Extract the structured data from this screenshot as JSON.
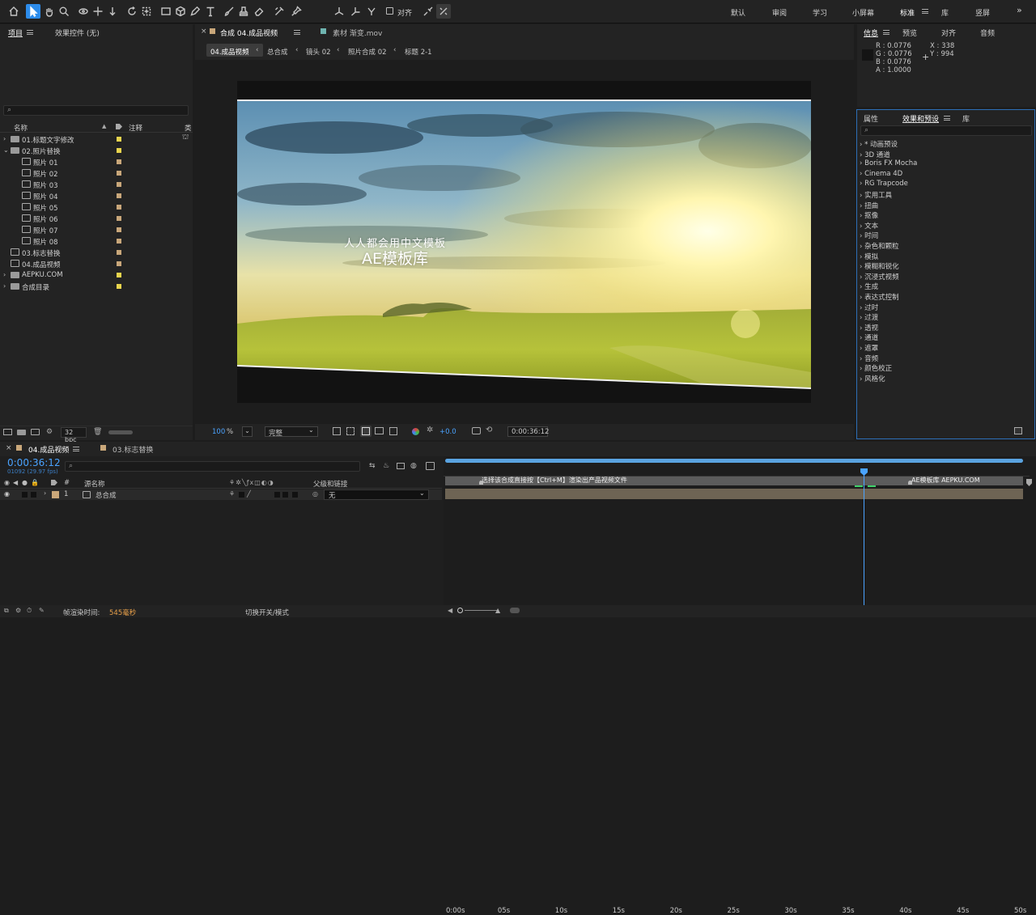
{
  "toolbar": {
    "tools": [
      "home-icon",
      "selection-tool-icon",
      "hand-tool-icon",
      "zoom-tool-icon",
      "orbit-camera-icon",
      "pan-camera-icon",
      "dolly-camera-icon",
      "rotation-tool-icon",
      "pan-behind-icon",
      "rectangle-tool-icon",
      "shape-3d-icon",
      "pen-tool-icon",
      "type-tool-icon",
      "brush-tool-icon",
      "clone-stamp-icon",
      "eraser-icon",
      "roto-brush-icon",
      "puppet-pin-icon"
    ],
    "snap_label": "对齐",
    "workspaces": [
      "默认",
      "审阅",
      "学习",
      "小屏幕",
      "标准",
      "库",
      "竖屏"
    ],
    "active_workspace": "标准",
    "more": "»"
  },
  "project_panel": {
    "tabs": [
      "项目",
      "效果控件 (无)"
    ],
    "columns": {
      "name": "名称",
      "comment": "注释",
      "type": "类"
    },
    "items": [
      {
        "label": "01.标题文字修改",
        "kind": "folder",
        "depth": 0,
        "expanded": false,
        "color": "#e8d44d"
      },
      {
        "label": "02.照片替换",
        "kind": "folder",
        "depth": 0,
        "expanded": true,
        "color": "#e8d44d"
      },
      {
        "label": "照片 01",
        "kind": "comp",
        "depth": 2,
        "color": "#c9a77a"
      },
      {
        "label": "照片 02",
        "kind": "comp",
        "depth": 2,
        "color": "#c9a77a"
      },
      {
        "label": "照片 03",
        "kind": "comp",
        "depth": 2,
        "color": "#c9a77a"
      },
      {
        "label": "照片 04",
        "kind": "comp",
        "depth": 2,
        "color": "#c9a77a"
      },
      {
        "label": "照片 05",
        "kind": "comp",
        "depth": 2,
        "color": "#c9a77a"
      },
      {
        "label": "照片 06",
        "kind": "comp",
        "depth": 2,
        "color": "#c9a77a"
      },
      {
        "label": "照片 07",
        "kind": "comp",
        "depth": 2,
        "color": "#c9a77a"
      },
      {
        "label": "照片 08",
        "kind": "comp",
        "depth": 2,
        "color": "#c9a77a"
      },
      {
        "label": "03.标志替换",
        "kind": "comp",
        "depth": 1,
        "color": "#c9a77a"
      },
      {
        "label": "04.成品视频",
        "kind": "comp",
        "depth": 1,
        "color": "#c9a77a"
      },
      {
        "label": "AEPKU.COM",
        "kind": "folder",
        "depth": 0,
        "expanded": false,
        "color": "#e8d44d"
      },
      {
        "label": "合成目录",
        "kind": "folder",
        "depth": 0,
        "expanded": false,
        "color": "#e8d44d"
      }
    ],
    "bpc": "32 bpc"
  },
  "viewer": {
    "tabs": [
      "合成 04.成品视频",
      "素材 渐变.mov"
    ],
    "breadcrumbs": [
      "04.成品视频",
      "总合成",
      "镜头 02",
      "照片合成 02",
      "标题 2-1"
    ],
    "overlay_line1": "人人都会用中文模板",
    "overlay_line2": "AE模板库",
    "zoom": "100",
    "zoom_unit": "%",
    "resolution": "完整",
    "exposure": "+0.0",
    "timecode": "0:00:36:12"
  },
  "info_panel": {
    "tabs": [
      "信息",
      "预览",
      "对齐",
      "音频"
    ],
    "r": "R : 0.0776",
    "g": "G : 0.0776",
    "b": "B : 0.0776",
    "a": "A : 1.0000",
    "x": "X : 338",
    "y": "Y : 994"
  },
  "effects_panel": {
    "tabs": [
      "属性",
      "效果和预设",
      "库"
    ],
    "items": [
      "* 动画预设",
      "3D 通道",
      "Boris FX Mocha",
      "Cinema 4D",
      "RG Trapcode",
      "实用工具",
      "扭曲",
      "抠像",
      "文本",
      "时间",
      "杂色和颗粒",
      "模拟",
      "模糊和锐化",
      "沉浸式视频",
      "生成",
      "表达式控制",
      "过时",
      "过渡",
      "透视",
      "通道",
      "遮罩",
      "音频",
      "颜色校正",
      "风格化"
    ]
  },
  "timeline": {
    "tabs": [
      "04.成品视频",
      "03.标志替换"
    ],
    "timecode": "0:00:36:12",
    "frame_info": "01092 (29.97 fps)",
    "columns": {
      "num": "#",
      "source": "源名称",
      "parent": "父级和链接"
    },
    "layer": {
      "num": "1",
      "name": "总合成",
      "parent": "无"
    },
    "ruler": [
      "0:00s",
      "05s",
      "10s",
      "15s",
      "20s",
      "25s",
      "30s",
      "35s",
      "40s",
      "45s",
      "50s"
    ],
    "markers": [
      "选择该合成直接按【Ctrl+M】渲染出产品视频文件",
      "AE模板库  AEPKU.COM"
    ],
    "footer_render_label": "帧渲染时间:",
    "footer_render_value": "545毫秒",
    "footer_toggle": "切换开关/模式"
  }
}
